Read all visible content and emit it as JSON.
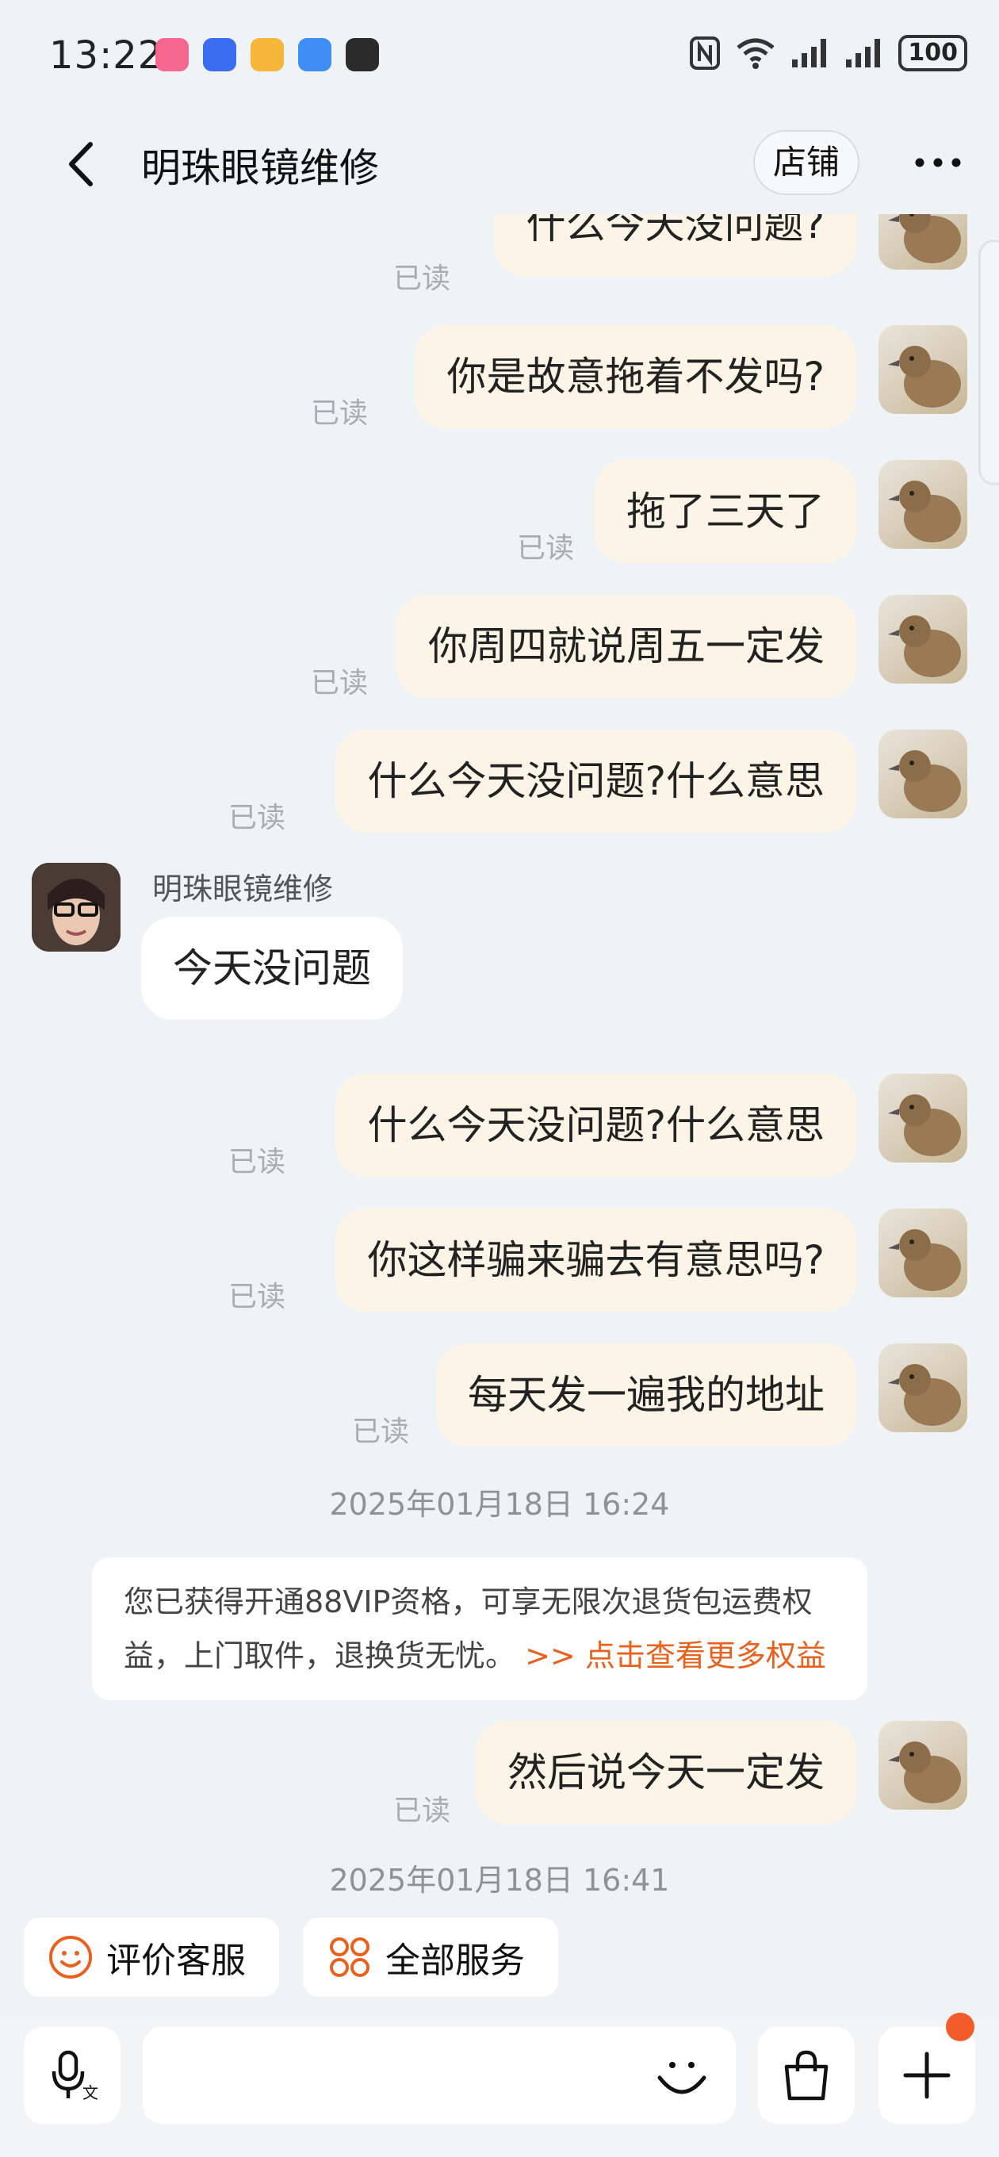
{
  "status_bar": {
    "time": "13:22",
    "battery": "100",
    "app_icon_colors": [
      "#f5678f",
      "#3b6cf2",
      "#f5b63a",
      "#3f8df5",
      "#2b2b2b"
    ],
    "icons": [
      "nfc-icon",
      "wifi-icon",
      "signal-icon",
      "signal-icon",
      "battery-icon"
    ]
  },
  "header": {
    "title": "明珠眼镜维修",
    "shop_label": "店铺"
  },
  "messages": {
    "m1": {
      "text": "什么今天没问题?",
      "status": "已读"
    },
    "m2": {
      "text": "你是故意拖着不发吗?",
      "status": "已读"
    },
    "m3": {
      "text": "拖了三天了",
      "status": "已读"
    },
    "m4": {
      "text": "你周四就说周五一定发",
      "status": "已读"
    },
    "m5": {
      "text": "什么今天没问题?什么意思",
      "status": "已读"
    },
    "shop_reply": {
      "sender": "明珠眼镜维修",
      "text": "今天没问题"
    },
    "m6": {
      "text": "什么今天没问题?什么意思",
      "status": "已读"
    },
    "m7": {
      "text": "你这样骗来骗去有意思吗?",
      "status": "已读"
    },
    "m8": {
      "text": "每天发一遍我的地址",
      "status": "已读"
    },
    "ts1": "2025年01月18日 16:24",
    "notice": {
      "text": "您已获得开通88VIP资格，可享无限次退货包运费权益，上门取件，退换货无忧。",
      "link": ">> 点击查看更多权益"
    },
    "m9": {
      "text": "然后说今天一定发",
      "status": "已读"
    },
    "ts2": "2025年01月18日 16:41"
  },
  "quick_actions": {
    "rate": "评价客服",
    "all_services": "全部服务"
  },
  "colors": {
    "accent": "#e8621e",
    "outgoing_bubble": "#fdf4e8",
    "background": "#eff3f6",
    "badge": "#f25b2a"
  }
}
